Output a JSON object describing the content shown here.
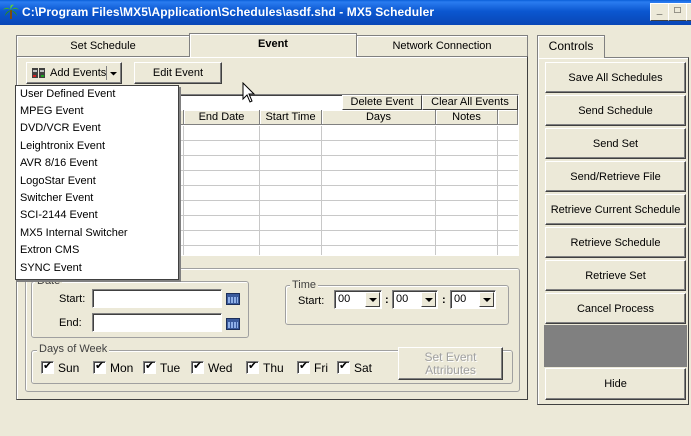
{
  "window": {
    "title": "C:\\Program Files\\MX5\\Application\\Schedules\\asdf.shd - MX5 Scheduler",
    "minimize": "_",
    "maximize": "□",
    "close": "x"
  },
  "tabs": [
    {
      "label": "Set Schedule",
      "active": false
    },
    {
      "label": "Event",
      "active": true
    },
    {
      "label": "Network Connection",
      "active": false
    }
  ],
  "toolbar": {
    "add_events": "Add Events",
    "edit_event": "Edit Event"
  },
  "add_events_menu": [
    "User Defined Event",
    "MPEG Event",
    "DVD/VCR Event",
    "Leightronix Event",
    "AVR 8/16 Event",
    "LogoStar Event",
    "Switcher Event",
    "SCI-2144 Event",
    "MX5 Internal Switcher",
    "Extron CMS",
    "SYNC Event"
  ],
  "grid": {
    "delete_event": "Delete Event",
    "clear_all_events": "Clear All Events",
    "columns": [
      "End Date",
      "Start Time",
      "Days",
      "Notes"
    ]
  },
  "date_group": {
    "label": "Date",
    "start_label": "Start:",
    "end_label": "End:",
    "start_value": "",
    "end_value": ""
  },
  "time_group": {
    "label": "Time",
    "start_label": "Start:",
    "hours": "00",
    "minutes": "00",
    "seconds": "00",
    "separator": ":"
  },
  "days_group": {
    "label": "Days of Week",
    "days": [
      "Sun",
      "Mon",
      "Tue",
      "Wed",
      "Thu",
      "Fri",
      "Sat"
    ]
  },
  "set_event_attributes": "Set Event Attributes",
  "controls": {
    "tab_label": "Controls",
    "buttons": [
      "Save All Schedules",
      "Send Schedule",
      "Send Set",
      "Send/Retrieve File",
      "Retrieve Current Schedule",
      "Retrieve Schedule",
      "Retrieve  Set",
      "Cancel Process"
    ],
    "hide": "Hide"
  }
}
